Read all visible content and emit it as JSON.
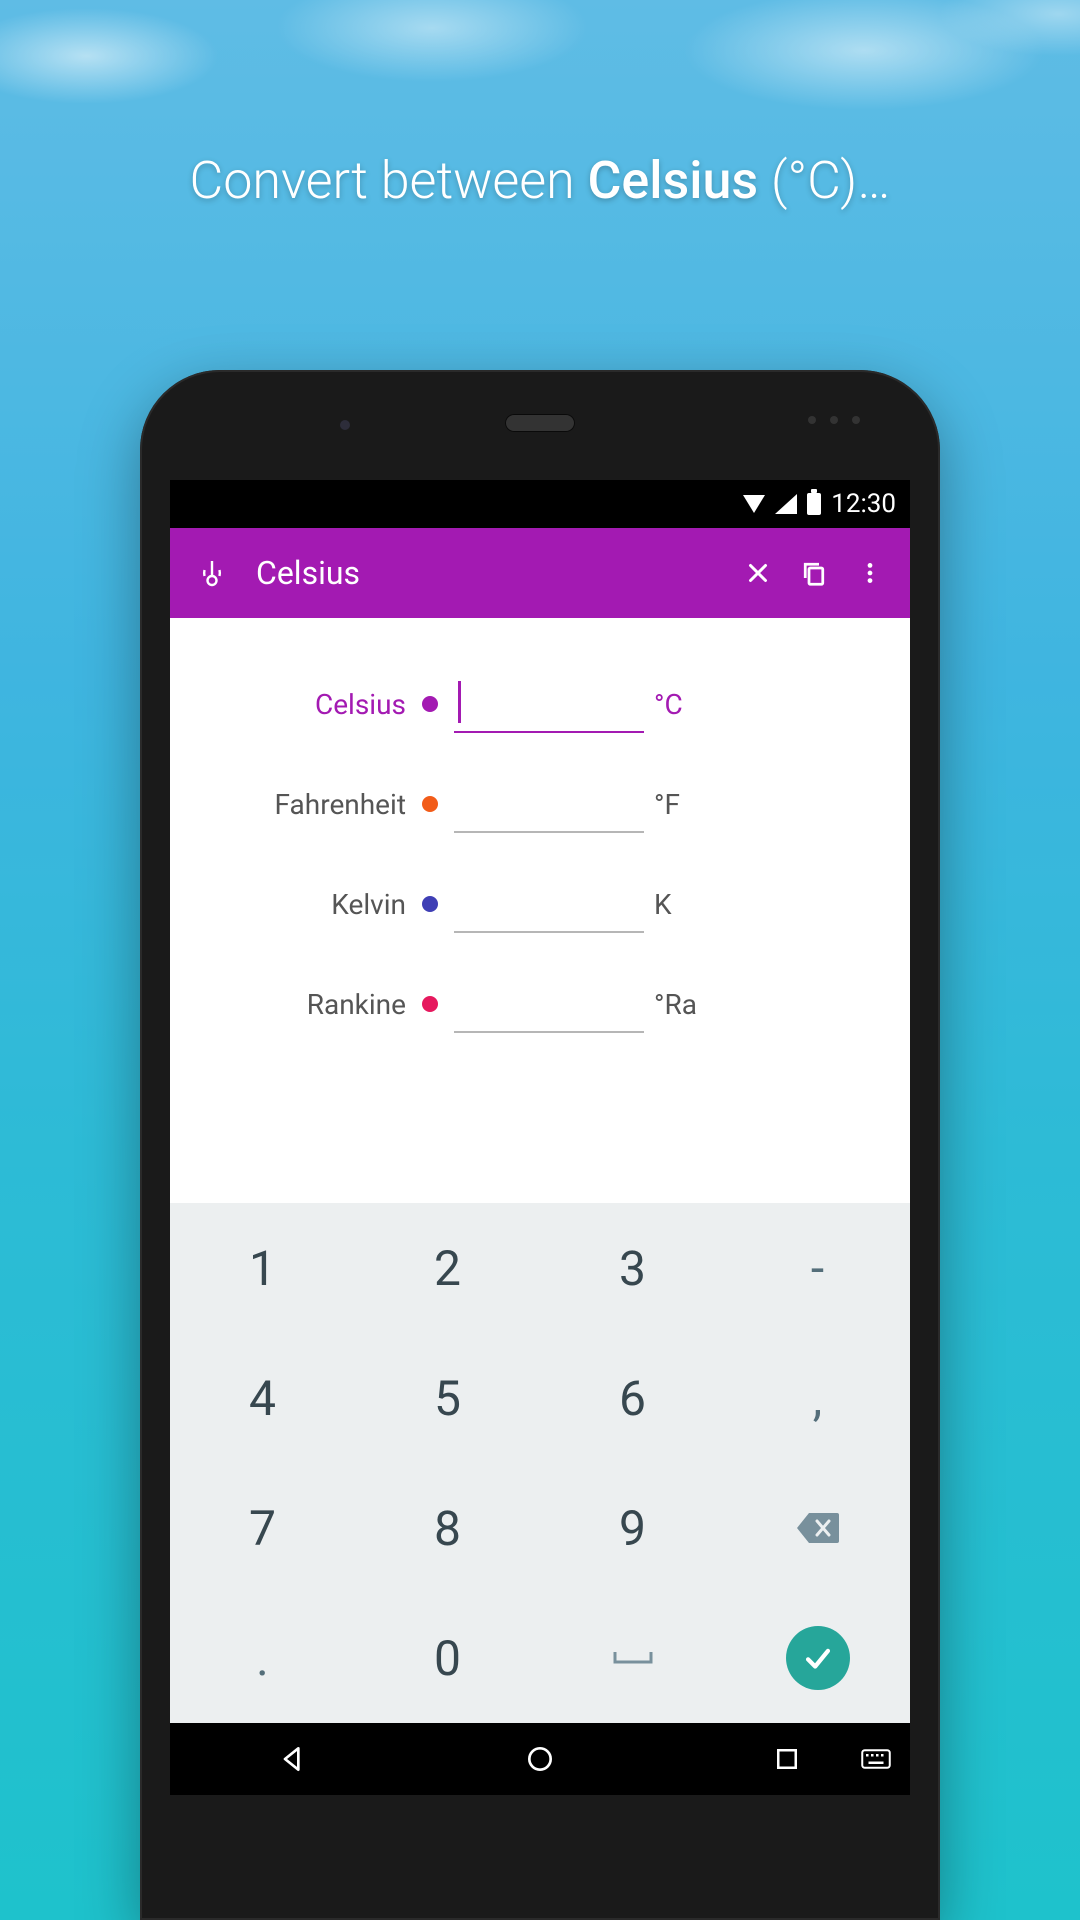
{
  "promo": {
    "prefix": "Convert between ",
    "bold": "Celsius",
    "suffix": " (°C)…"
  },
  "statusbar": {
    "time": "12:30"
  },
  "appbar": {
    "title": "Celsius"
  },
  "units": [
    {
      "label": "Celsius",
      "dot": "#A31AB2",
      "symbol": "°C",
      "active": true
    },
    {
      "label": "Fahrenheit",
      "dot": "#F25C19",
      "symbol": "°F",
      "active": false
    },
    {
      "label": "Kelvin",
      "dot": "#3F3FB5",
      "symbol": "K",
      "active": false
    },
    {
      "label": "Rankine",
      "dot": "#E6195E",
      "symbol": "°Ra",
      "active": false
    }
  ],
  "keypad": {
    "rows": [
      [
        "1",
        "2",
        "3",
        "-"
      ],
      [
        "4",
        "5",
        "6",
        ","
      ],
      [
        "7",
        "8",
        "9",
        "__BACKSPACE__"
      ],
      [
        ".",
        "0",
        "__SPACE__",
        "__DONE__"
      ]
    ]
  },
  "colors": {
    "accent": "#A31AB2",
    "doneGreen": "#26A69A"
  }
}
